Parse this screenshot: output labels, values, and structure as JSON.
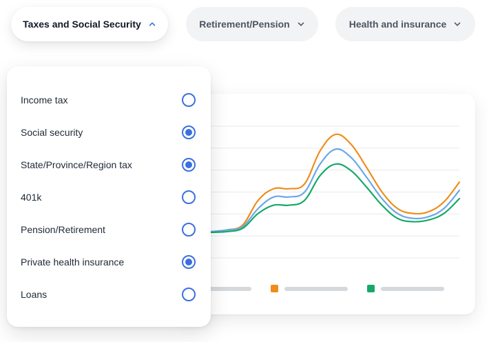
{
  "tabs": [
    {
      "label": "Taxes and Social Security",
      "expanded": true
    },
    {
      "label": "Retirement/Pension",
      "expanded": false
    },
    {
      "label": "Health and insurance",
      "expanded": false
    }
  ],
  "options": [
    {
      "label": "Income tax",
      "checked": false
    },
    {
      "label": "Social security",
      "checked": true
    },
    {
      "label": "State/Province/Region tax",
      "checked": true
    },
    {
      "label": "401k",
      "checked": false
    },
    {
      "label": "Pension/Retirement",
      "checked": false
    },
    {
      "label": "Private health insurance",
      "checked": true
    },
    {
      "label": "Loans",
      "checked": false
    }
  ],
  "colors": {
    "accent": "#3b6fe0",
    "series_orange": "#f08c1a",
    "series_blue": "#6aa7e8",
    "series_green": "#16a86a"
  },
  "chart_data": {
    "type": "line",
    "grid": true,
    "ylim": [
      0,
      8
    ],
    "x": [
      0,
      1,
      2,
      3,
      4,
      5,
      6,
      7,
      8,
      9,
      10,
      11,
      12,
      13,
      14,
      15,
      16,
      17
    ],
    "series": [
      {
        "color": "#f08c1a",
        "values": [
          1.5,
          1.6,
          1.7,
          2.0,
          3.5,
          4.2,
          4.2,
          4.5,
          6.5,
          7.5,
          6.9,
          5.5,
          4.0,
          3.0,
          2.7,
          2.8,
          3.4,
          4.6
        ]
      },
      {
        "color": "#6aa7e8",
        "values": [
          1.5,
          1.6,
          1.7,
          1.9,
          3.0,
          3.7,
          3.7,
          4.0,
          5.7,
          6.6,
          6.1,
          4.9,
          3.6,
          2.7,
          2.4,
          2.5,
          3.0,
          4.1
        ]
      },
      {
        "color": "#16a86a",
        "values": [
          1.5,
          1.55,
          1.6,
          1.8,
          2.7,
          3.2,
          3.2,
          3.5,
          5.0,
          5.7,
          5.3,
          4.3,
          3.2,
          2.4,
          2.2,
          2.3,
          2.7,
          3.6
        ]
      }
    ]
  }
}
